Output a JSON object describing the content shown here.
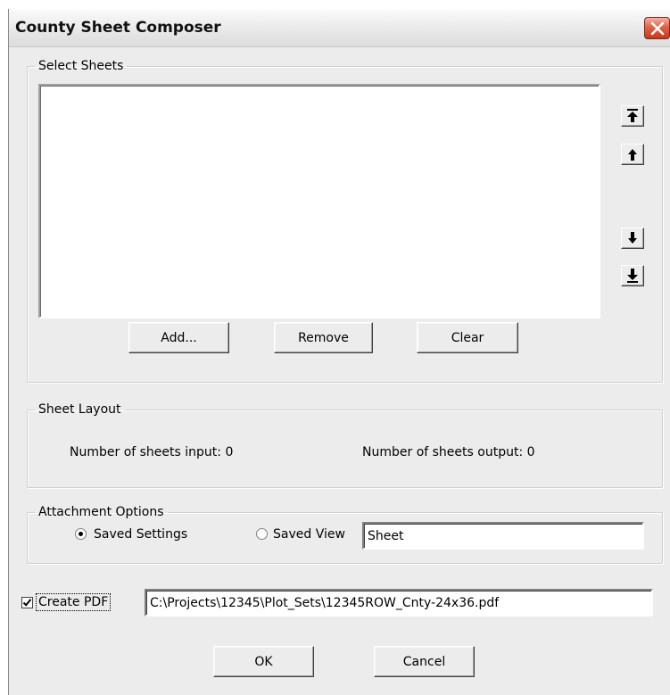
{
  "window": {
    "title": "County Sheet Composer"
  },
  "select_sheets": {
    "legend": "Select Sheets",
    "items": [],
    "buttons": {
      "add": "Add...",
      "remove": "Remove",
      "clear": "Clear"
    }
  },
  "sheet_layout": {
    "legend": "Sheet Layout",
    "input_text": "Number of sheets input: 0",
    "output_text": "Number of sheets output: 0"
  },
  "attachment_options": {
    "legend": "Attachment Options",
    "saved_settings_label": "Saved Settings",
    "saved_view_label": "Saved View",
    "saved_settings_selected": true,
    "saved_view_value": "Sheet"
  },
  "create_pdf": {
    "checked": true,
    "label": "Create PDF",
    "path": "C:\\Projects\\12345\\Plot_Sets\\12345ROW_Cnty-24x36.pdf"
  },
  "footer": {
    "ok": "OK",
    "cancel": "Cancel"
  },
  "icons": {
    "close": "close-icon",
    "move_top": "move-to-top-icon",
    "move_up": "move-up-icon",
    "move_down": "move-down-icon",
    "move_bottom": "move-to-bottom-icon"
  }
}
